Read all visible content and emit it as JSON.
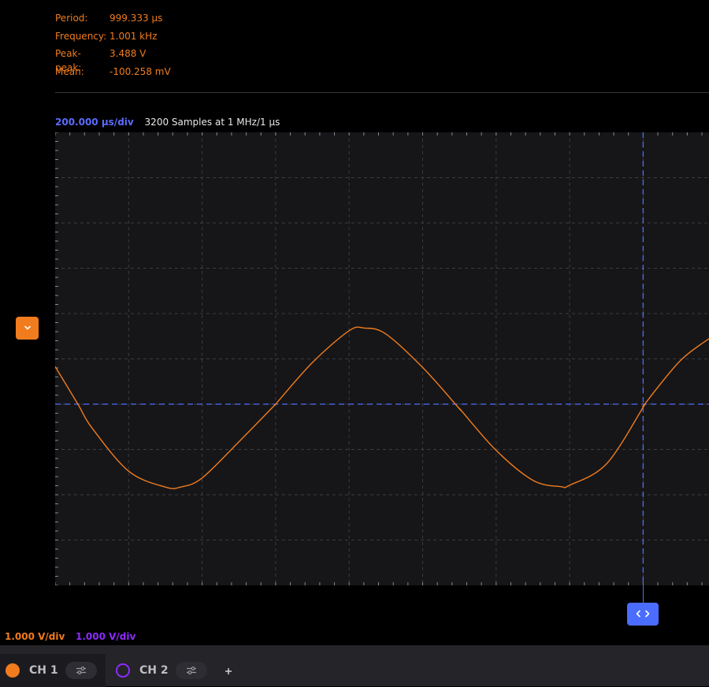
{
  "measurements": [
    {
      "label": "Period:",
      "value": "999.333 µs"
    },
    {
      "label": "Frequency:",
      "value": "1.001 kHz"
    },
    {
      "label": "Peak-peak:",
      "value": "3.488 V"
    },
    {
      "label": "Mean:",
      "value": "-100.258 mV"
    }
  ],
  "timebase": {
    "per_div": "200.000 µs/div",
    "samples": "3200 Samples at 1 MHz/1 µs"
  },
  "channels": [
    {
      "name": "CH 1",
      "volts_per_div": "1.000 V/div",
      "color": "#f07c1e",
      "active": true
    },
    {
      "name": "CH 2",
      "volts_per_div": "1.000 V/div",
      "color": "#8d2bff",
      "active": false
    }
  ],
  "icons": {
    "offset_marker": "chevron-down-icon",
    "trigger_handle": "chevrons-left-right-icon",
    "channel_settings": "sliders-icon",
    "add_channel": "plus-icon"
  },
  "colors": {
    "trigger": "#4b6dff",
    "grid": "#3c3c40",
    "background": "#161618"
  },
  "chart_data": {
    "type": "line",
    "title": "",
    "xlabel": "",
    "ylabel": "",
    "x_divisions": 10,
    "y_divisions": 10,
    "grid": true,
    "xlim_div": [
      0,
      10
    ],
    "ylim_div": [
      -4,
      6
    ],
    "trigger_time_div": 8.0,
    "trigger_level_div": 0,
    "series": [
      {
        "name": "CH 1",
        "color": "#f07c1e",
        "x_div": [
          0,
          0.31,
          0.5,
          1.0,
          1.5,
          1.71,
          2.0,
          2.5,
          3.0,
          3.0,
          3.5,
          4.0,
          4.21,
          4.5,
          5.0,
          5.5,
          5.52,
          6.0,
          6.5,
          6.88,
          7.0,
          7.5,
          8.0,
          8.02,
          8.5,
          8.9
        ],
        "y_div": [
          0.83,
          0,
          -0.52,
          -1.48,
          -1.83,
          -1.83,
          -1.63,
          -0.83,
          0,
          0,
          0.92,
          1.62,
          1.68,
          1.55,
          0.81,
          -0.1,
          -0.13,
          -1.02,
          -1.68,
          -1.82,
          -1.79,
          -1.32,
          -0.07,
          0,
          0.95,
          1.45
        ]
      }
    ]
  }
}
